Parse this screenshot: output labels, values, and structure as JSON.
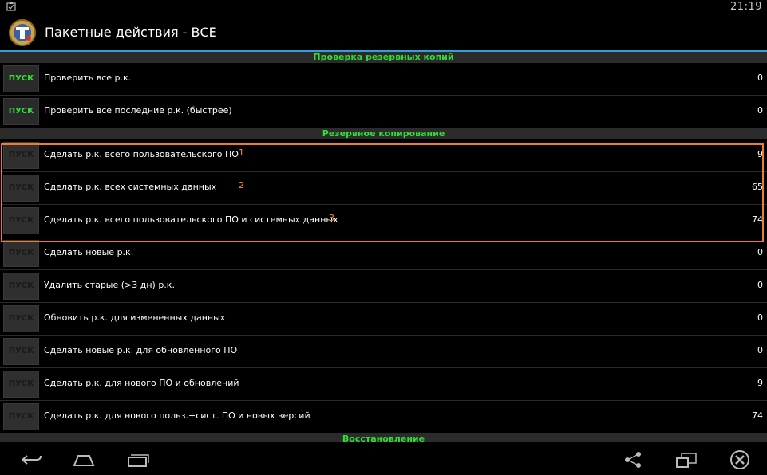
{
  "status": {
    "time": "21:19"
  },
  "app": {
    "title": "Пакетные действия - ВСЕ"
  },
  "sections": [
    {
      "title": "Проверка резервных копий",
      "rows": [
        {
          "button": "ПУСК",
          "label": "Проверить все р.к.",
          "count": "0",
          "active": true
        },
        {
          "button": "ПУСК",
          "label": "Проверить все последние р.к. (быстрее)",
          "count": "0",
          "active": true
        }
      ]
    },
    {
      "title": "Резервное копирование",
      "rows": [
        {
          "button": "ПУСК",
          "label": "Сделать р.к. всего пользовательского ПО",
          "note": "1",
          "count": "9"
        },
        {
          "button": "ПУСК",
          "label": "Сделать р.к. всех системных данных",
          "note": "2",
          "count": "65"
        },
        {
          "button": "ПУСК",
          "label": "Сделать р.к. всего пользовательского ПО и системных данных",
          "note": "3",
          "count": "74"
        },
        {
          "button": "ПУСК",
          "label": "Сделать новые р.к.",
          "count": "0"
        },
        {
          "button": "ПУСК",
          "label": "Удалить старые (>3 дн) р.к.",
          "count": "0"
        },
        {
          "button": "ПУСК",
          "label": "Обновить р.к. для измененных данных",
          "count": "0"
        },
        {
          "button": "ПУСК",
          "label": "Сделать новые р.к. для обновленного ПО",
          "count": "0"
        },
        {
          "button": "ПУСК",
          "label": "Сделать р.к. для нового ПО и обновлений",
          "count": "9"
        },
        {
          "button": "ПУСК",
          "label": "Сделать р.к. для нового польз.+сист. ПО и новых версий",
          "count": "74"
        }
      ]
    },
    {
      "title": "Восстановление",
      "rows": []
    }
  ],
  "nav": {
    "icons": [
      "back-icon",
      "home-icon",
      "recent-apps-icon",
      "share-icon",
      "screen-mirror-icon",
      "close-icon"
    ]
  },
  "colors": {
    "section_title": "#33dd33",
    "highlight": "#f07a30",
    "accent": "#3a9bd6"
  }
}
